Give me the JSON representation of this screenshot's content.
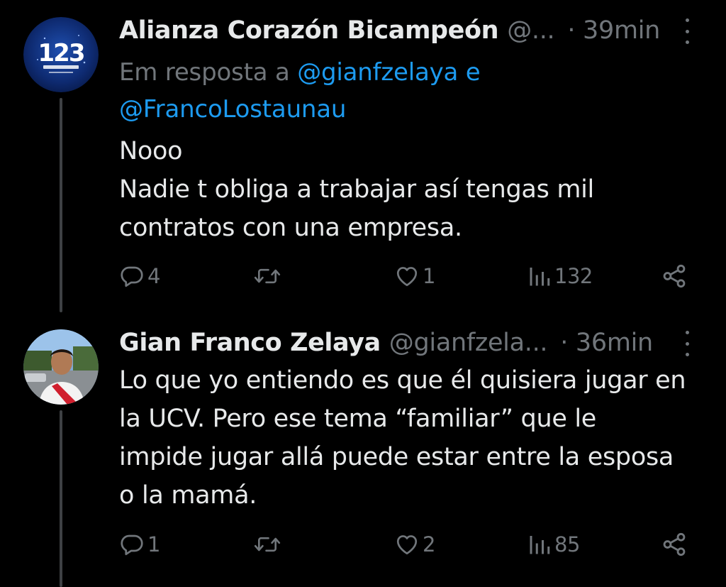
{
  "tweets": [
    {
      "display_name": "Alianza Corazón Bicampeón",
      "handle": "@...",
      "time": "· 39min",
      "reply_prefix": "Em resposta a",
      "reply_mention_1": "@gianfzelaya",
      "reply_conjunction": "e",
      "reply_mention_2": "@FrancoLostaunau",
      "body_lines": [
        "Nooo",
        "Nadie t obliga a trabajar así tengas mil",
        "contratos con una empresa."
      ],
      "avatar_text": "123",
      "replies": "4",
      "retweets": "",
      "likes": "1",
      "views": "132"
    },
    {
      "display_name": "Gian Franco Zelaya",
      "handle": "@gianfzela...",
      "time": "· 36min",
      "body_lines": [
        "Lo que yo entiendo es que él quisiera jugar en",
        "la UCV. Pero ese tema “familiar” que le",
        "impide jugar allá puede estar entre la esposa",
        "o la mamá."
      ],
      "replies": "1",
      "retweets": "",
      "likes": "2",
      "views": "85"
    }
  ],
  "icons": {
    "reply": "reply-icon",
    "retweet": "retweet-icon",
    "like": "heart-icon",
    "views": "views-icon",
    "share": "share-icon",
    "more": "more-icon"
  },
  "colors": {
    "background": "#000000",
    "text": "#e7e9ea",
    "secondary": "#71767b",
    "link": "#1d9bf0",
    "thread_line": "#3e4144"
  }
}
